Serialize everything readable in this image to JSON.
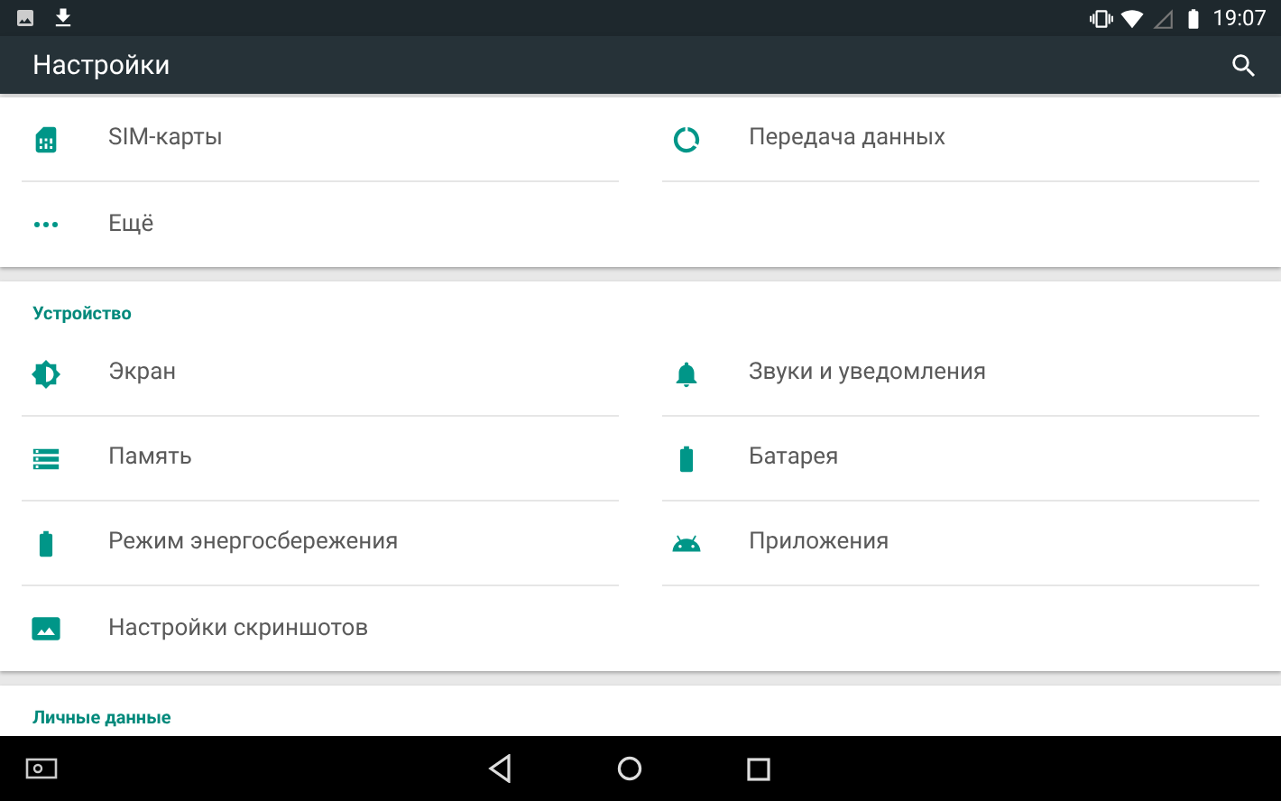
{
  "status_bar": {
    "time": "19:07"
  },
  "app_bar": {
    "title": "Настройки"
  },
  "sections": [
    {
      "rows": [
        [
          {
            "label": "SIM-карты"
          },
          {
            "label": "Передача данных"
          }
        ],
        [
          {
            "label": "Ещё"
          }
        ]
      ]
    },
    {
      "header": "Устройство",
      "rows": [
        [
          {
            "label": "Экран"
          },
          {
            "label": "Звуки и уведомления"
          }
        ],
        [
          {
            "label": "Память"
          },
          {
            "label": "Батарея"
          }
        ],
        [
          {
            "label": "Режим энергосбережения"
          },
          {
            "label": "Приложения"
          }
        ],
        [
          {
            "label": "Настройки скриншотов"
          }
        ]
      ]
    },
    {
      "header": "Личные данные"
    }
  ]
}
